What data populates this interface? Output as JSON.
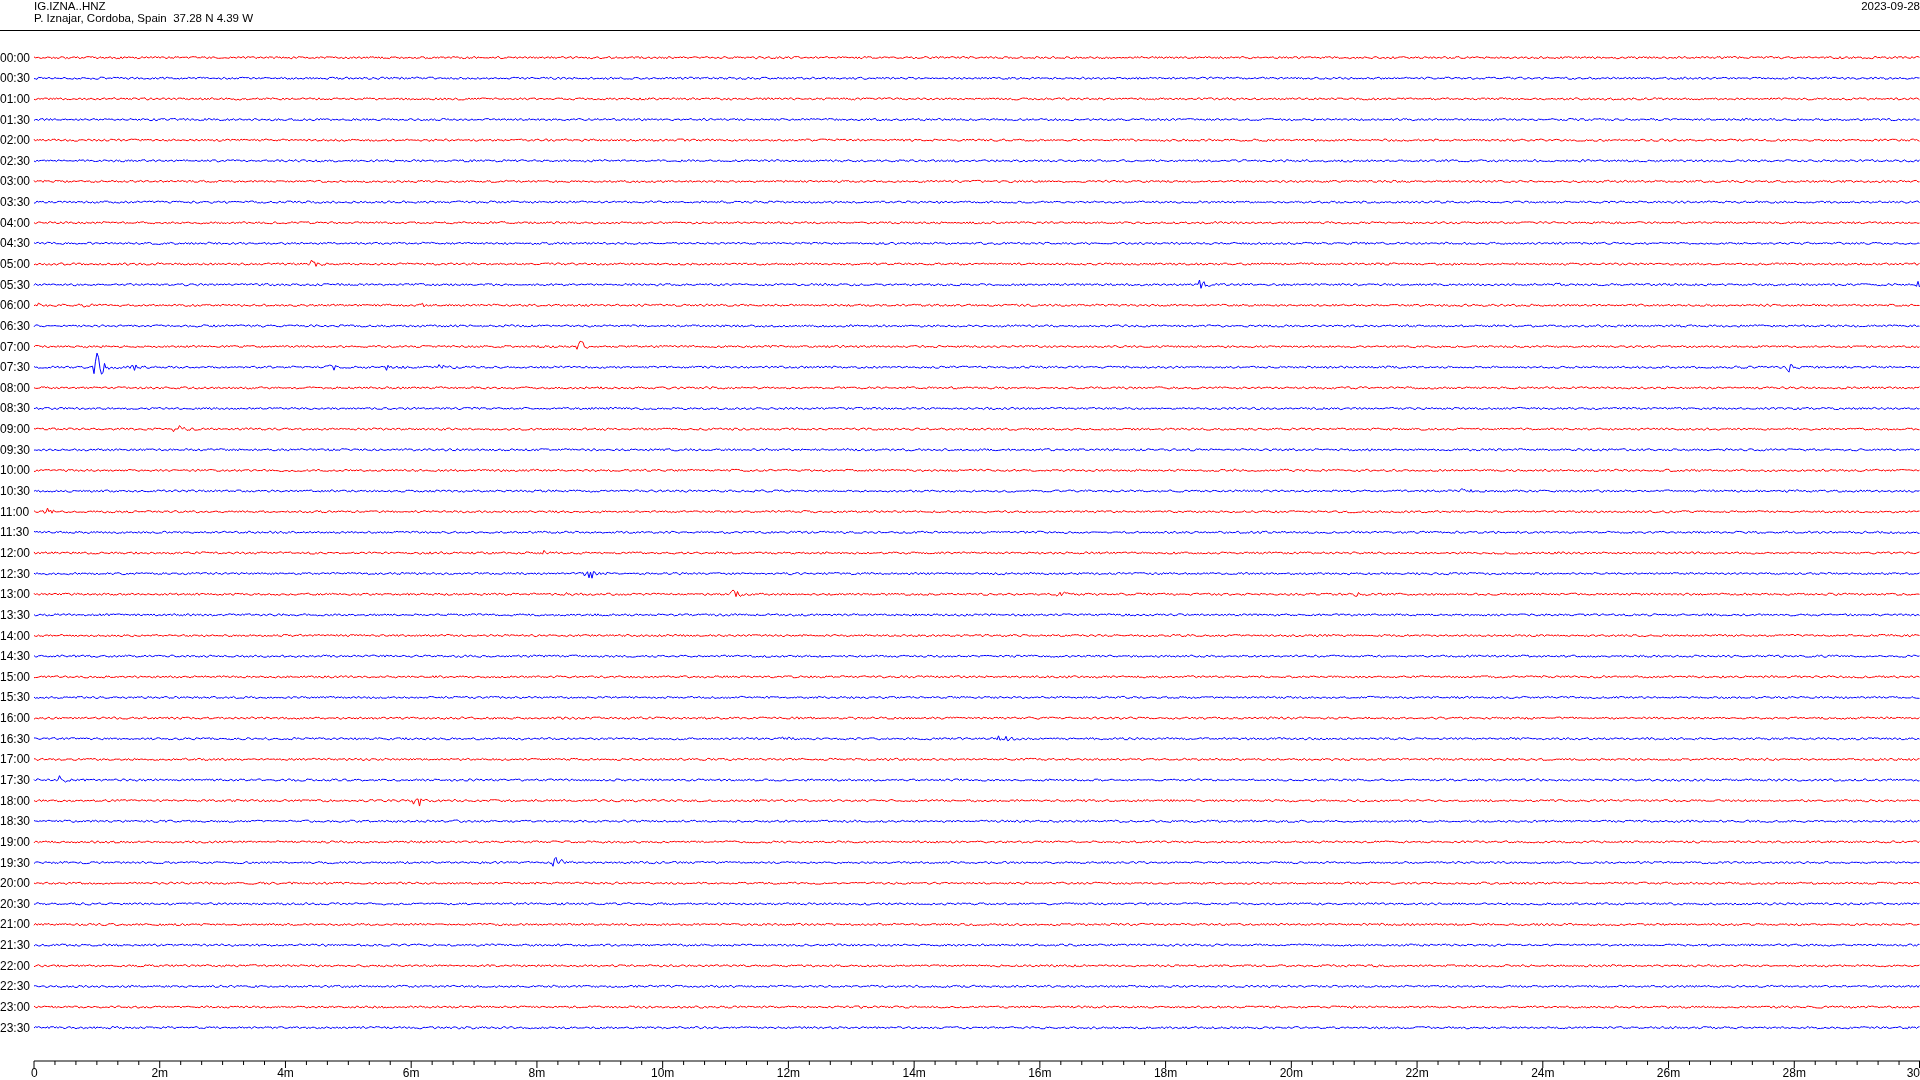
{
  "header": {
    "station": "IG.IZNA..HNZ",
    "location": "P. Iznajar, Cordoba, Spain  37.28 N 4.39 W",
    "date": "2023-09-28"
  },
  "traces": [
    {
      "time": "00:00",
      "color": "#ff0000"
    },
    {
      "time": "00:30",
      "color": "#0000ff"
    },
    {
      "time": "01:00",
      "color": "#ff0000"
    },
    {
      "time": "01:30",
      "color": "#0000ff"
    },
    {
      "time": "02:00",
      "color": "#ff0000"
    },
    {
      "time": "02:30",
      "color": "#0000ff"
    },
    {
      "time": "03:00",
      "color": "#ff0000"
    },
    {
      "time": "03:30",
      "color": "#0000ff"
    },
    {
      "time": "04:00",
      "color": "#ff0000"
    },
    {
      "time": "04:30",
      "color": "#0000ff"
    },
    {
      "time": "05:00",
      "color": "#ff0000"
    },
    {
      "time": "05:30",
      "color": "#0000ff"
    },
    {
      "time": "06:00",
      "color": "#ff0000"
    },
    {
      "time": "06:30",
      "color": "#0000ff"
    },
    {
      "time": "07:00",
      "color": "#ff0000"
    },
    {
      "time": "07:30",
      "color": "#0000ff"
    },
    {
      "time": "08:00",
      "color": "#ff0000"
    },
    {
      "time": "08:30",
      "color": "#0000ff"
    },
    {
      "time": "09:00",
      "color": "#ff0000"
    },
    {
      "time": "09:30",
      "color": "#0000ff"
    },
    {
      "time": "10:00",
      "color": "#ff0000"
    },
    {
      "time": "10:30",
      "color": "#0000ff"
    },
    {
      "time": "11:00",
      "color": "#ff0000"
    },
    {
      "time": "11:30",
      "color": "#0000ff"
    },
    {
      "time": "12:00",
      "color": "#ff0000"
    },
    {
      "time": "12:30",
      "color": "#0000ff"
    },
    {
      "time": "13:00",
      "color": "#ff0000"
    },
    {
      "time": "13:30",
      "color": "#0000ff"
    },
    {
      "time": "14:00",
      "color": "#ff0000"
    },
    {
      "time": "14:30",
      "color": "#0000ff"
    },
    {
      "time": "15:00",
      "color": "#ff0000"
    },
    {
      "time": "15:30",
      "color": "#0000ff"
    },
    {
      "time": "16:00",
      "color": "#ff0000"
    },
    {
      "time": "16:30",
      "color": "#0000ff"
    },
    {
      "time": "17:00",
      "color": "#ff0000"
    },
    {
      "time": "17:30",
      "color": "#0000ff"
    },
    {
      "time": "18:00",
      "color": "#ff0000"
    },
    {
      "time": "18:30",
      "color": "#0000ff"
    },
    {
      "time": "19:00",
      "color": "#ff0000"
    },
    {
      "time": "19:30",
      "color": "#0000ff"
    },
    {
      "time": "20:00",
      "color": "#ff0000"
    },
    {
      "time": "20:30",
      "color": "#0000ff"
    },
    {
      "time": "21:00",
      "color": "#ff0000"
    },
    {
      "time": "21:30",
      "color": "#0000ff"
    },
    {
      "time": "22:00",
      "color": "#ff0000"
    },
    {
      "time": "22:30",
      "color": "#0000ff"
    },
    {
      "time": "23:00",
      "color": "#ff0000"
    },
    {
      "time": "23:30",
      "color": "#0000ff"
    }
  ],
  "time_axis": {
    "labels": [
      "0",
      "2m",
      "4m",
      "6m",
      "8m",
      "10m",
      "12m",
      "14m",
      "16m",
      "18m",
      "20m",
      "22m",
      "24m",
      "26m",
      "28m",
      "30"
    ]
  }
}
